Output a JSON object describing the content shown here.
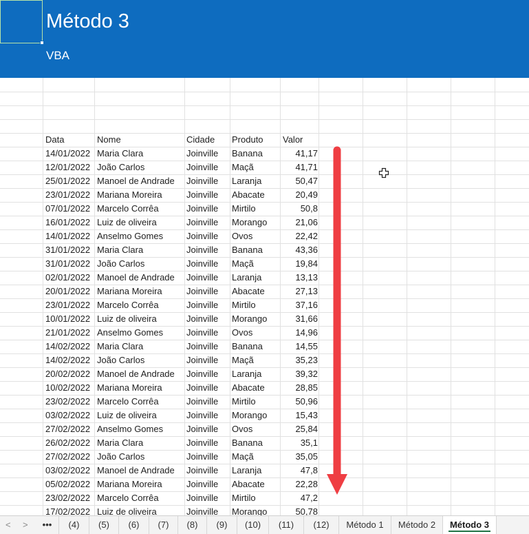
{
  "header": {
    "title": "Método 3",
    "subtitle": "VBA",
    "color": "#0e6cbf"
  },
  "table": {
    "headers": {
      "date": "Data",
      "name": "Nome",
      "city": "Cidade",
      "product": "Produto",
      "value": "Valor"
    },
    "rows": [
      [
        "14/01/2022",
        "Maria Clara",
        "Joinville",
        "Banana",
        "41,17"
      ],
      [
        "12/01/2022",
        "João Carlos",
        "Joinville",
        "Maçã",
        "41,71"
      ],
      [
        "25/01/2022",
        "Manoel de Andrade",
        "Joinville",
        "Laranja",
        "50,47"
      ],
      [
        "23/01/2022",
        "Mariana Moreira",
        "Joinville",
        "Abacate",
        "20,49"
      ],
      [
        "07/01/2022",
        "Marcelo Corrêa",
        "Joinville",
        "Mirtilo",
        "50,8"
      ],
      [
        "16/01/2022",
        "Luiz de oliveira",
        "Joinville",
        "Morango",
        "21,06"
      ],
      [
        "14/01/2022",
        "Anselmo Gomes",
        "Joinville",
        "Ovos",
        "22,42"
      ],
      [
        "31/01/2022",
        "Maria Clara",
        "Joinville",
        "Banana",
        "43,36"
      ],
      [
        "31/01/2022",
        "João Carlos",
        "Joinville",
        "Maçã",
        "19,84"
      ],
      [
        "02/01/2022",
        "Manoel de Andrade",
        "Joinville",
        "Laranja",
        "13,13"
      ],
      [
        "20/01/2022",
        "Mariana Moreira",
        "Joinville",
        "Abacate",
        "27,13"
      ],
      [
        "23/01/2022",
        "Marcelo Corrêa",
        "Joinville",
        "Mirtilo",
        "37,16"
      ],
      [
        "10/01/2022",
        "Luiz de oliveira",
        "Joinville",
        "Morango",
        "31,66"
      ],
      [
        "21/01/2022",
        "Anselmo Gomes",
        "Joinville",
        "Ovos",
        "14,96"
      ],
      [
        "14/02/2022",
        "Maria Clara",
        "Joinville",
        "Banana",
        "14,55"
      ],
      [
        "14/02/2022",
        "João Carlos",
        "Joinville",
        "Maçã",
        "35,23"
      ],
      [
        "20/02/2022",
        "Manoel de Andrade",
        "Joinville",
        "Laranja",
        "39,32"
      ],
      [
        "10/02/2022",
        "Mariana Moreira",
        "Joinville",
        "Abacate",
        "28,85"
      ],
      [
        "23/02/2022",
        "Marcelo Corrêa",
        "Joinville",
        "Mirtilo",
        "50,96"
      ],
      [
        "03/02/2022",
        "Luiz de oliveira",
        "Joinville",
        "Morango",
        "15,43"
      ],
      [
        "27/02/2022",
        "Anselmo Gomes",
        "Joinville",
        "Ovos",
        "25,84"
      ],
      [
        "26/02/2022",
        "Maria Clara",
        "Joinville",
        "Banana",
        "35,1"
      ],
      [
        "27/02/2022",
        "João Carlos",
        "Joinville",
        "Maçã",
        "35,05"
      ],
      [
        "03/02/2022",
        "Manoel de Andrade",
        "Joinville",
        "Laranja",
        "47,8"
      ],
      [
        "05/02/2022",
        "Mariana Moreira",
        "Joinville",
        "Abacate",
        "22,28"
      ],
      [
        "23/02/2022",
        "Marcelo Corrêa",
        "Joinville",
        "Mirtilo",
        "47,2"
      ],
      [
        "17/02/2022",
        "Luiz de oliveira",
        "Joinville",
        "Morango",
        "50,78"
      ]
    ]
  },
  "annotation": {
    "arrow_color": "#ef3e43",
    "arrow_icon": "down-arrow-icon"
  },
  "sheet_tabs": {
    "overflow_label": "•••",
    "tabs": [
      "(4)",
      "(5)",
      "(6)",
      "(7)",
      "(8)",
      "(9)",
      "(10)",
      "(11)",
      "(12)",
      "Método 1",
      "Método 2",
      "Método 3"
    ],
    "active": "Método 3",
    "active_underline_color": "#217346"
  }
}
